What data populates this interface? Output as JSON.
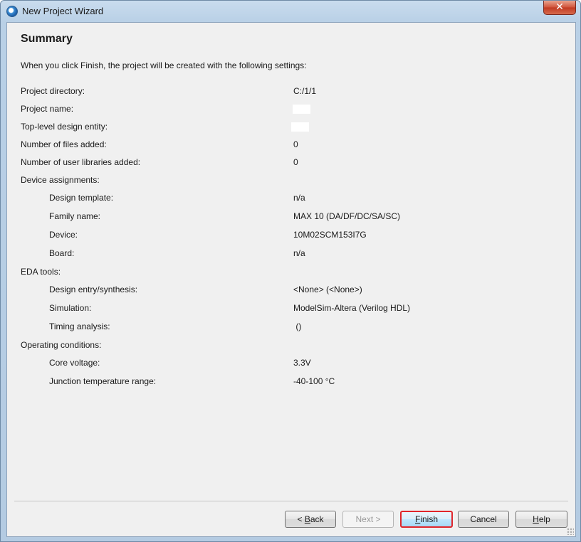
{
  "window": {
    "title": "New Project Wizard",
    "close_glyph": "✕"
  },
  "heading": "Summary",
  "intro": "When you click Finish, the project will be created with the following settings:",
  "rows": [
    {
      "label": "Project directory:",
      "value": "C:/1/1"
    },
    {
      "label": "Project name:",
      "value": ""
    },
    {
      "label": "Top-level design entity:",
      "value": ""
    },
    {
      "label": "Number of files added:",
      "value": "0"
    },
    {
      "label": "Number of user libraries added:",
      "value": "0"
    },
    {
      "label": "Device assignments:",
      "value": ""
    },
    {
      "label": "Design template:",
      "value": "n/a"
    },
    {
      "label": "Family name:",
      "value": "MAX 10 (DA/DF/DC/SA/SC)"
    },
    {
      "label": "Device:",
      "value": "10M02SCM153I7G"
    },
    {
      "label": "Board:",
      "value": "n/a"
    },
    {
      "label": "EDA tools:",
      "value": ""
    },
    {
      "label": "Design entry/synthesis:",
      "value": "<None> (<None>)"
    },
    {
      "label": "Simulation:",
      "value": "ModelSim-Altera (Verilog HDL)"
    },
    {
      "label": "Timing analysis:",
      "value": " ()"
    },
    {
      "label": "Operating conditions:",
      "value": ""
    },
    {
      "label": "Core voltage:",
      "value": "3.3V"
    },
    {
      "label": "Junction temperature range:",
      "value": "-40-100 °C"
    }
  ],
  "buttons": {
    "back": {
      "underline": "B",
      "rest": "ack",
      "prefix": "< "
    },
    "next": {
      "label": "Next >"
    },
    "finish": {
      "underline": "F",
      "rest": "inish"
    },
    "cancel": {
      "label": "Cancel"
    },
    "help": {
      "underline": "H",
      "rest": "elp"
    }
  }
}
